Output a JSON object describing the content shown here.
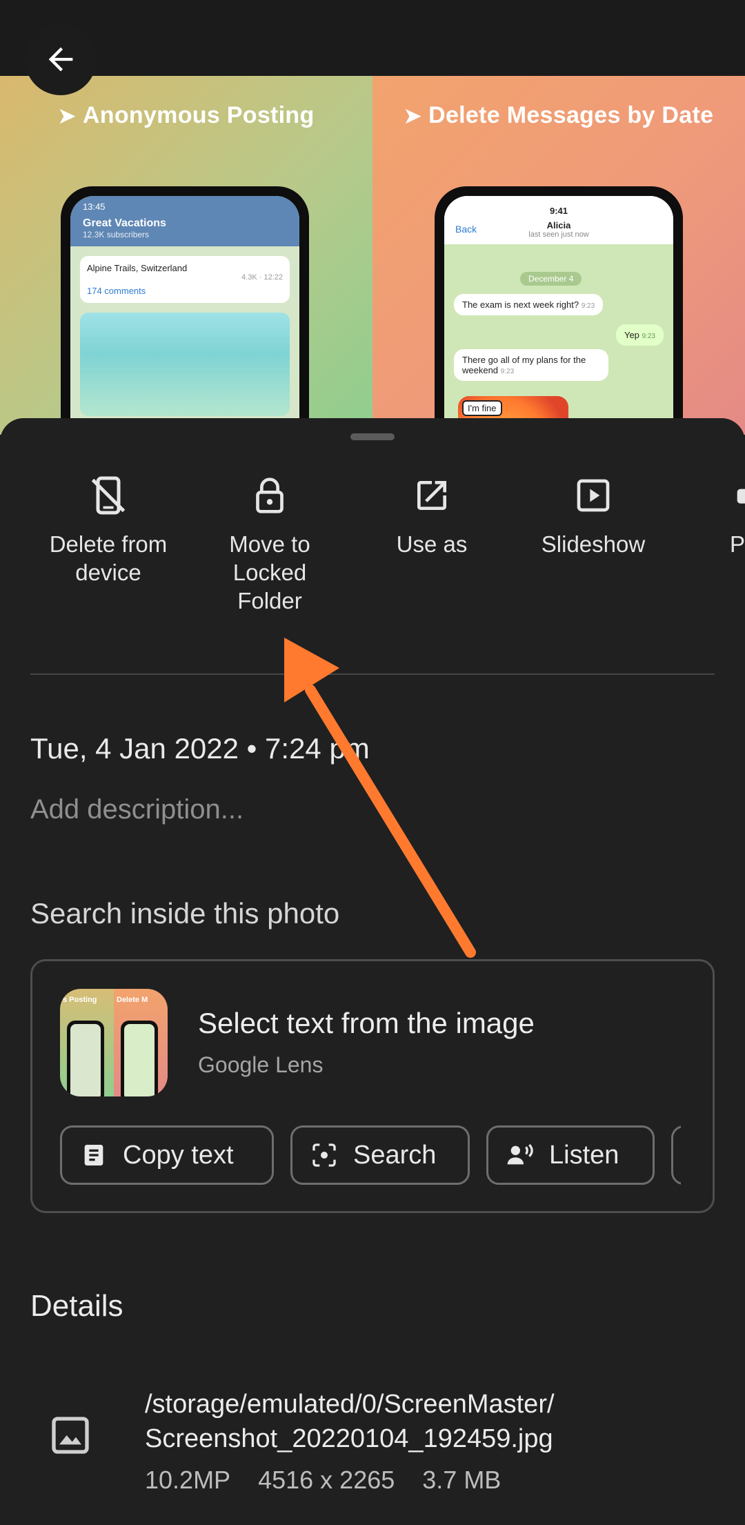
{
  "banner": {
    "left_title": "Anonymous Posting",
    "right_title": "Delete Messages by Date",
    "left_phone": {
      "time": "13:45",
      "channel": "Great Vacations",
      "subscribers": "12.3K subscribers",
      "post_title": "Alpine Trails, Switzerland",
      "views": "4.3K",
      "post_time": "12:22",
      "comments": "174 comments"
    },
    "right_phone": {
      "time": "9:41",
      "back": "Back",
      "contact": "Alicia",
      "last_seen": "last seen just now",
      "date_chip": "December 4",
      "msg1": "The exam is next week right?",
      "msg1_time": "9:23",
      "msg2": "Yep",
      "msg2_time": "9:23",
      "msg3": "There go all of my plans for the weekend",
      "msg3_time": "9:23",
      "sticker_text": "I'm fine"
    },
    "thumb_left_text": "s Posting",
    "thumb_right_text": "Delete M"
  },
  "actions": [
    {
      "label": "Delete from device",
      "icon": "phone-off-icon"
    },
    {
      "label": "Move to Locked Folder",
      "icon": "lock-icon"
    },
    {
      "label": "Use as",
      "icon": "open-external-icon"
    },
    {
      "label": "Slideshow",
      "icon": "play-icon"
    },
    {
      "label": "P",
      "icon": "print-icon"
    }
  ],
  "info": {
    "date": "Tue, 4 Jan 2022  •  7:24 pm",
    "description_placeholder": "Add description..."
  },
  "lens": {
    "section_title": "Search inside this photo",
    "card_title": "Select text from the image",
    "card_subtitle": "Google Lens",
    "chips": [
      {
        "label": "Copy text",
        "icon": "document-icon"
      },
      {
        "label": "Search",
        "icon": "lens-search-icon"
      },
      {
        "label": "Listen",
        "icon": "listen-icon"
      },
      {
        "label": "",
        "icon": "translate-icon"
      }
    ]
  },
  "details": {
    "title": "Details",
    "path_line1": "/storage/emulated/0/ScreenMaster/",
    "path_line2": "Screenshot_20220104_192459.jpg",
    "megapixels": "10.2MP",
    "dimensions": "4516 x 2265",
    "size": "3.7 MB"
  },
  "colors": {
    "sheet_bg": "#202020",
    "annotation_arrow": "#ff7a2f"
  }
}
